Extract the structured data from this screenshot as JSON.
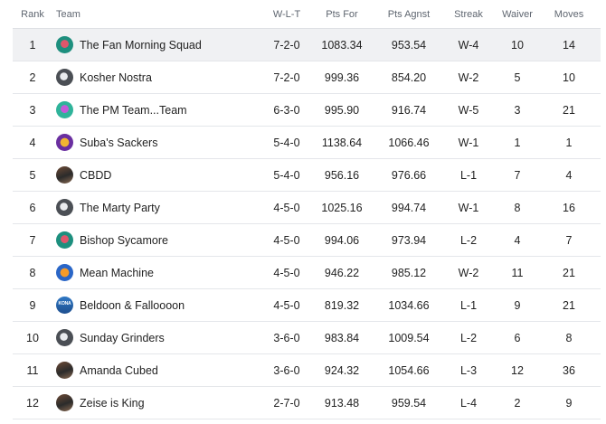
{
  "columns": {
    "rank": "Rank",
    "team": "Team",
    "wlt": "W-L-T",
    "pts_for": "Pts For",
    "pts_against": "Pts Agnst",
    "streak": "Streak",
    "waiver": "Waiver",
    "moves": "Moves"
  },
  "rows": [
    {
      "rank": "1",
      "team": "The Fan Morning Squad",
      "wlt": "7-2-0",
      "pts_for": "1083.34",
      "pts_against": "953.54",
      "streak": "W-4",
      "waiver": "10",
      "moves": "14",
      "avatar_icon": "red-ball-avatar-icon"
    },
    {
      "rank": "2",
      "team": "Kosher Nostra",
      "wlt": "7-2-0",
      "pts_for": "999.36",
      "pts_against": "854.20",
      "streak": "W-2",
      "waiver": "5",
      "moves": "10",
      "avatar_icon": "default-helmet-avatar-icon"
    },
    {
      "rank": "3",
      "team": "The PM Team...Team",
      "wlt": "6-3-0",
      "pts_for": "995.90",
      "pts_against": "916.74",
      "streak": "W-5",
      "waiver": "3",
      "moves": "21",
      "avatar_icon": "purple-ball-avatar-icon"
    },
    {
      "rank": "4",
      "team": "Suba's Sackers",
      "wlt": "5-4-0",
      "pts_for": "1138.64",
      "pts_against": "1066.46",
      "streak": "W-1",
      "waiver": "1",
      "moves": "1",
      "avatar_icon": "purple-gold-avatar-icon"
    },
    {
      "rank": "5",
      "team": "CBDD",
      "wlt": "5-4-0",
      "pts_for": "956.16",
      "pts_against": "976.66",
      "streak": "L-1",
      "waiver": "7",
      "moves": "4",
      "avatar_icon": "photo-avatar-icon"
    },
    {
      "rank": "6",
      "team": "The Marty Party",
      "wlt": "4-5-0",
      "pts_for": "1025.16",
      "pts_against": "994.74",
      "streak": "W-1",
      "waiver": "8",
      "moves": "16",
      "avatar_icon": "default-helmet-avatar-icon"
    },
    {
      "rank": "7",
      "team": "Bishop Sycamore",
      "wlt": "4-5-0",
      "pts_for": "994.06",
      "pts_against": "973.94",
      "streak": "L-2",
      "waiver": "4",
      "moves": "7",
      "avatar_icon": "red-ball-avatar-icon"
    },
    {
      "rank": "8",
      "team": "Mean Machine",
      "wlt": "4-5-0",
      "pts_for": "946.22",
      "pts_against": "985.12",
      "streak": "W-2",
      "waiver": "11",
      "moves": "21",
      "avatar_icon": "blue-orange-avatar-icon"
    },
    {
      "rank": "9",
      "team": "Beldoon & Falloooon",
      "wlt": "4-5-0",
      "pts_for": "819.32",
      "pts_against": "1034.66",
      "streak": "L-1",
      "waiver": "9",
      "moves": "21",
      "avatar_icon": "kona-avatar-icon",
      "avatar_text": "KONA"
    },
    {
      "rank": "10",
      "team": "Sunday Grinders",
      "wlt": "3-6-0",
      "pts_for": "983.84",
      "pts_against": "1009.54",
      "streak": "L-2",
      "waiver": "6",
      "moves": "8",
      "avatar_icon": "default-helmet-avatar-icon"
    },
    {
      "rank": "11",
      "team": "Amanda Cubed",
      "wlt": "3-6-0",
      "pts_for": "924.32",
      "pts_against": "1054.66",
      "streak": "L-3",
      "waiver": "12",
      "moves": "36",
      "avatar_icon": "photo-avatar-icon"
    },
    {
      "rank": "12",
      "team": "Zeise is King",
      "wlt": "2-7-0",
      "pts_for": "913.48",
      "pts_against": "959.54",
      "streak": "L-4",
      "waiver": "2",
      "moves": "9",
      "avatar_icon": "photo-avatar-icon"
    }
  ],
  "colors": {
    "highlight_row": "#f0f1f3",
    "divider": "#e4e6ea",
    "text": "#222222",
    "header_text": "#5f6670"
  }
}
